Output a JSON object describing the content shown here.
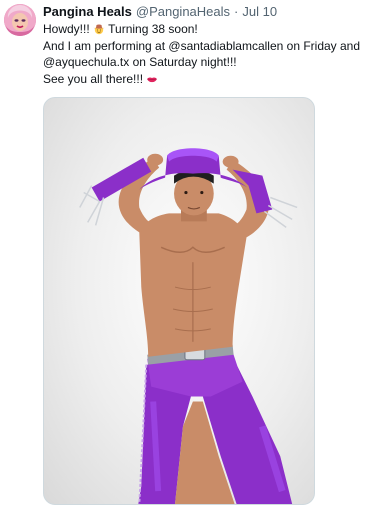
{
  "tweet": {
    "display_name": "Pangina Heals",
    "handle": "@PanginaHeals",
    "separator": "·",
    "date": "Jul 10",
    "lines": [
      {
        "before": "Howdy!!! ",
        "emoji": "cowboy-hat-face-emoji",
        "after": " Turning 38 soon!"
      },
      {
        "text": "And I am performing at @santadiablamcallen on Friday and"
      },
      {
        "text": "@ayquechula.tx on Saturday night!!!"
      },
      {
        "before": "See you all there!!! ",
        "emoji": "kiss-mark-emoji",
        "after": ""
      }
    ],
    "avatar_icon": "avatar-image",
    "media_icon": "photo-performer-purple-cowboy-costume"
  },
  "colors": {
    "text": "#0f1419",
    "secondary": "#536471",
    "border": "#cfd9de",
    "costume_purple": "#8b2fc9"
  }
}
